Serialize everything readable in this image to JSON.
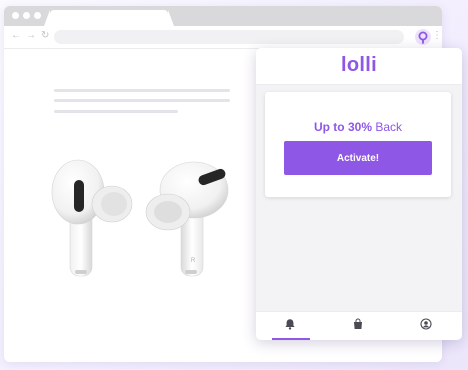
{
  "browser": {
    "nav_icons": {
      "back": "←",
      "forward": "→",
      "reload": "↻"
    },
    "kebab": "⋮",
    "extension_icon": "lolli-extension-icon"
  },
  "popup": {
    "logo": "lolli",
    "offer": {
      "prefix": "Up to ",
      "amount": "30%",
      "suffix": " Back"
    },
    "activate_label": "Activate!",
    "nav": [
      {
        "icon": "bell-icon",
        "active": true
      },
      {
        "icon": "shopping-bag-icon",
        "active": false
      },
      {
        "icon": "user-icon",
        "active": false
      }
    ]
  },
  "product": {
    "earbud_mark": "R"
  },
  "colors": {
    "brand": "#8e57e6",
    "nav_icon": "#4a4a55"
  }
}
